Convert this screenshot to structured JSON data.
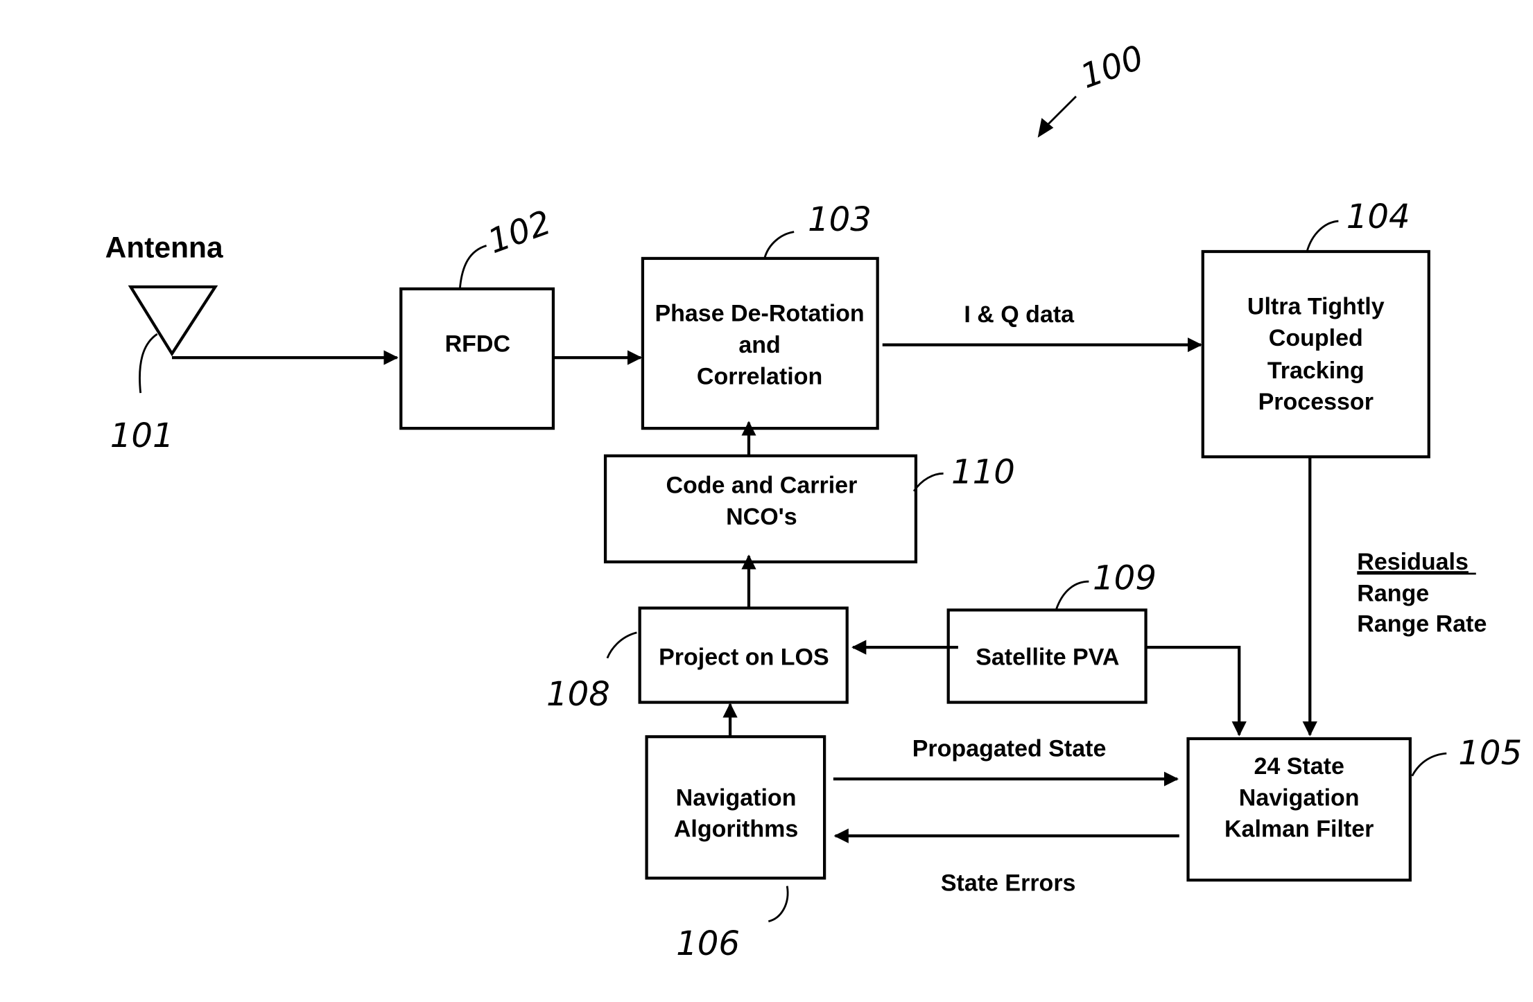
{
  "figure": {
    "reference_number": "100",
    "antenna": {
      "title": "Antenna",
      "ref": "101"
    },
    "blocks": [
      {
        "id": "rfdc",
        "ref": "102",
        "lines": [
          "RFDC"
        ]
      },
      {
        "id": "phase",
        "ref": "103",
        "lines": [
          "Phase De-Rotation",
          "and",
          "Correlation"
        ]
      },
      {
        "id": "utc",
        "ref": "104",
        "lines": [
          "Ultra Tightly",
          "Coupled",
          "Tracking",
          "Processor"
        ]
      },
      {
        "id": "kalman",
        "ref": "105",
        "lines": [
          "24 State",
          "Navigation",
          "Kalman Filter"
        ]
      },
      {
        "id": "nav",
        "ref": "106",
        "lines": [
          "Navigation",
          "Algorithms"
        ]
      },
      {
        "id": "los",
        "ref": "108",
        "lines": [
          "Project on LOS"
        ]
      },
      {
        "id": "pva",
        "ref": "109",
        "lines": [
          "Satellite PVA"
        ]
      },
      {
        "id": "nco",
        "ref": "110",
        "lines": [
          "Code and Carrier",
          "NCO's"
        ]
      }
    ],
    "edge_labels": {
      "iq": "I & Q data",
      "propagated": "Propagated State",
      "errors": "State Errors",
      "residuals_title": "Residuals",
      "residuals_items": [
        "Range",
        "Range Rate"
      ]
    }
  }
}
